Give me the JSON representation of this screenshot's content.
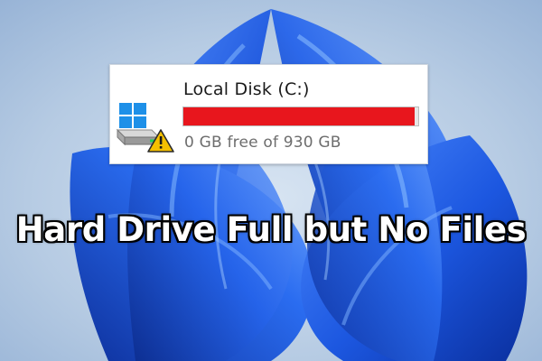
{
  "drive": {
    "name": "Local Disk (C:)",
    "free_text": "0 GB free of 930 GB",
    "used_fraction": 0.985,
    "bar_color": "#e8161d",
    "icons": [
      "windows-logo-icon",
      "hard-drive-icon",
      "warning-icon"
    ]
  },
  "headline": "Hard Drive Full but No Files",
  "colors": {
    "background": "#a9c2de",
    "bloom": "#1f5fe0",
    "headline_text": "#ffffff",
    "headline_outline": "#000000"
  }
}
